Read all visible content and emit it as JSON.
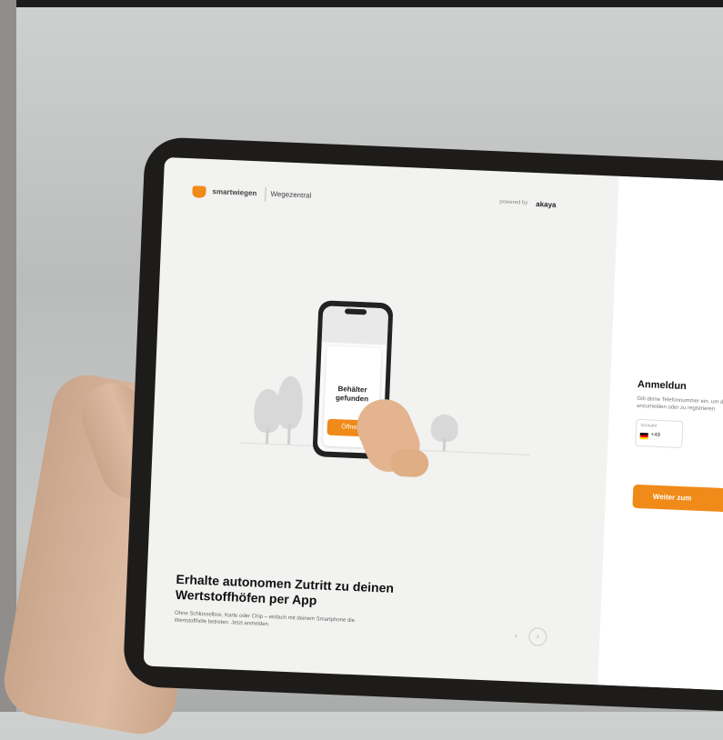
{
  "app": {
    "brand_name": "smartwiegen",
    "brand_suffix": "Wegezentral",
    "powered_by": "powered by",
    "partner_name": "akaya"
  },
  "illustration": {
    "card_title": "Behälter gefunden",
    "card_button": "Öffnen"
  },
  "hero": {
    "headline": "Erhalte autonomen Zutritt zu deinen Wertstoffhöfen per App",
    "subtext": "Ohne Schlüsselbox, Karte oder Chip – einfach mit deinem Smartphone die Wertstoffhöfe betreten. Jetzt anmelden."
  },
  "pager": {
    "prev": "‹",
    "next": "›"
  },
  "login": {
    "title": "Anmeldun",
    "description": "Gib deine Telefonnummer ein, um dich anzumelden oder zu registrieren",
    "country_label": "Vorwahl",
    "country_prefix": "+49",
    "submit_label": "Weiter zum"
  },
  "colors": {
    "accent": "#f08a18",
    "bezel": "#1e1c1b",
    "screen_bg": "#f2f2f1"
  }
}
